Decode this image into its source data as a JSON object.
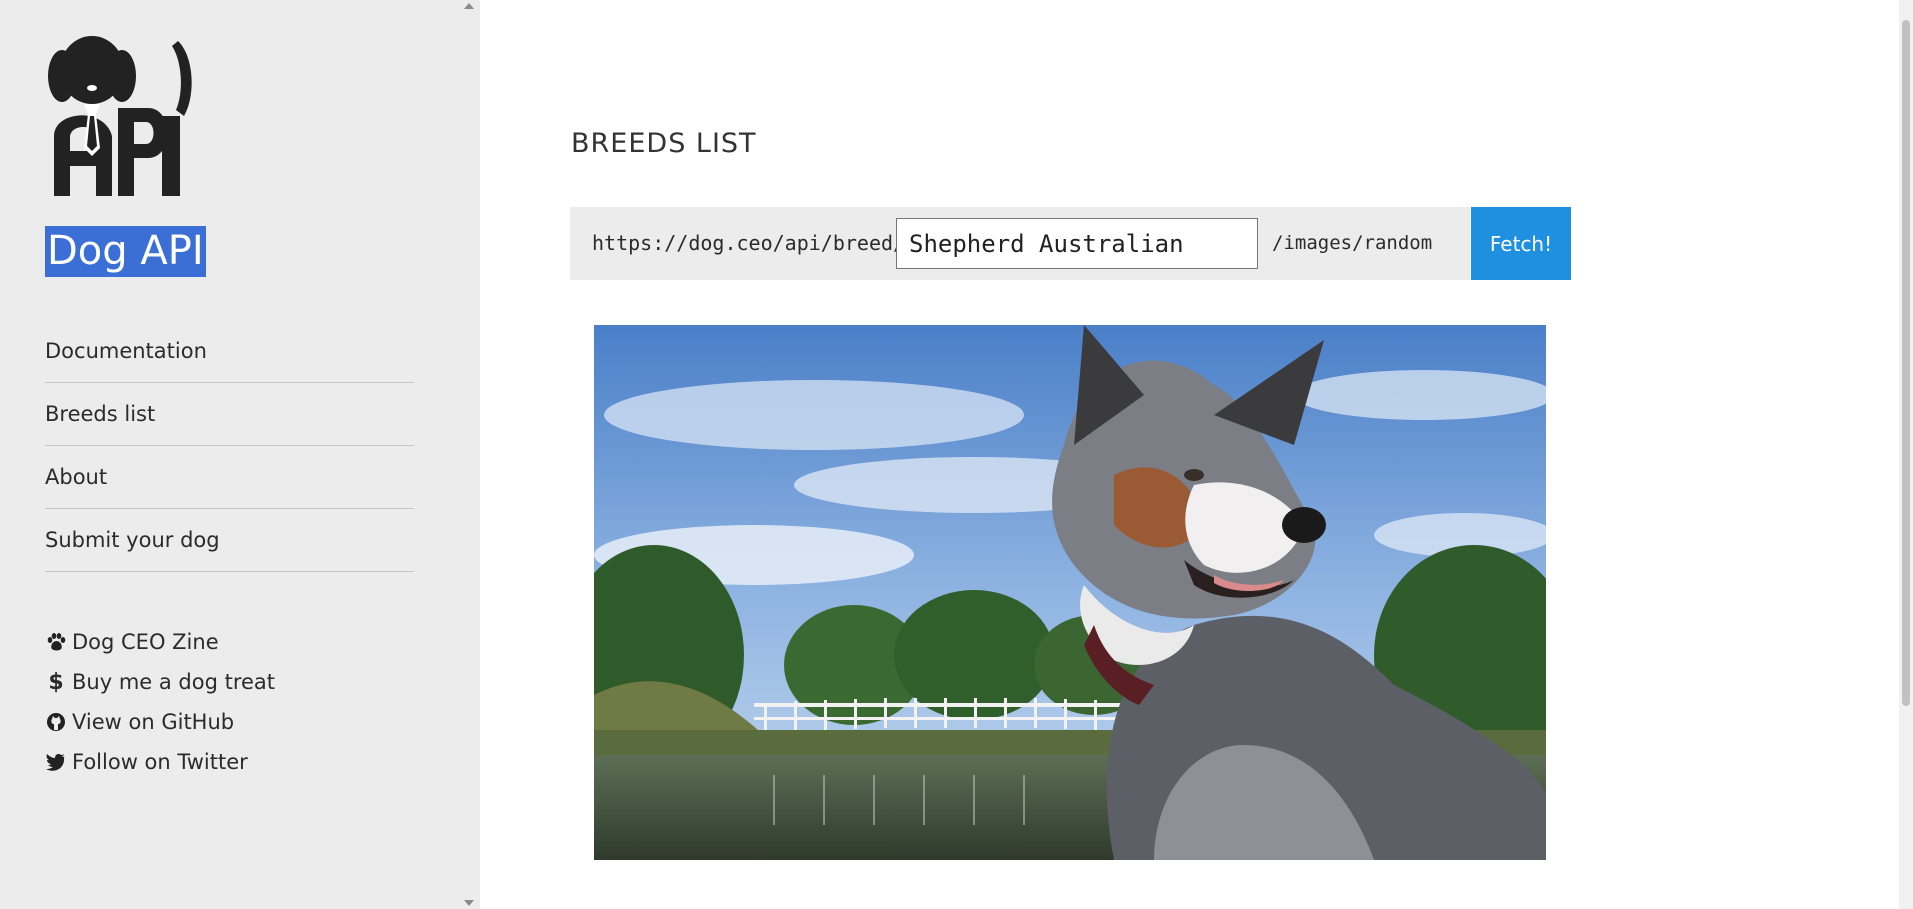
{
  "sidebar": {
    "site_title": "Dog API",
    "nav": [
      {
        "label": "Documentation"
      },
      {
        "label": "Breeds list"
      },
      {
        "label": "About"
      },
      {
        "label": "Submit your dog"
      }
    ],
    "links": [
      {
        "icon": "paw-icon",
        "label": "Dog CEO Zine"
      },
      {
        "icon": "dollar-icon",
        "label": "Buy me a dog treat"
      },
      {
        "icon": "github-icon",
        "label": "View on GitHub"
      },
      {
        "icon": "twitter-icon",
        "label": "Follow on Twitter"
      }
    ]
  },
  "main": {
    "title": "BREEDS LIST",
    "url_prefix": "https://dog.ceo/api/breed/",
    "breed_input_value": "Shepherd Australian",
    "url_suffix": "/images/random",
    "fetch_label": "Fetch!"
  },
  "colors": {
    "accent": "#1f8fe0",
    "title_highlight": "#3b6fd6",
    "sidebar_bg": "#ececec"
  }
}
